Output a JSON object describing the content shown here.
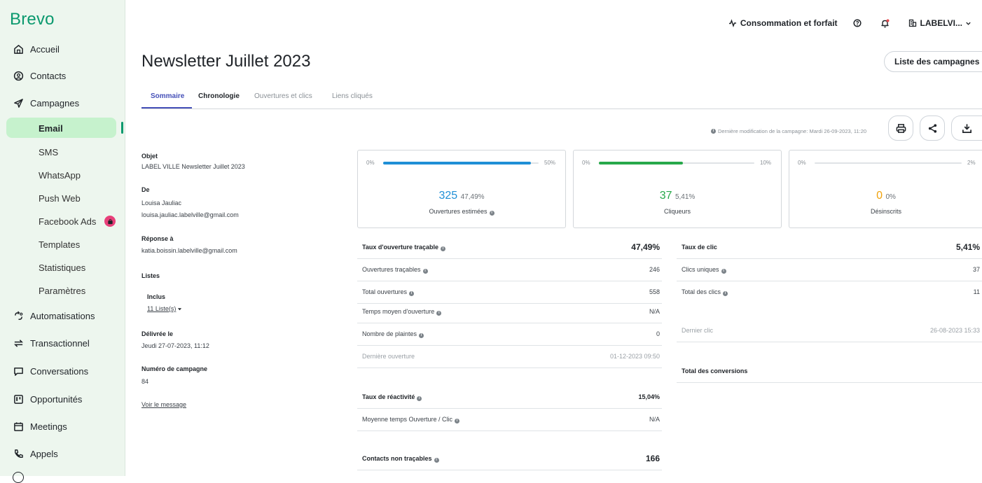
{
  "app": {
    "logo": "Brevo"
  },
  "sidebar": {
    "main_items": [
      {
        "label": "Accueil",
        "icon": "home-icon"
      },
      {
        "label": "Contacts",
        "icon": "contacts-icon"
      },
      {
        "label": "Campagnes",
        "icon": "send-icon"
      }
    ],
    "sub_items": [
      "Email",
      "SMS",
      "WhatsApp",
      "Push Web",
      "Facebook Ads",
      "Templates",
      "Statistiques",
      "Paramètres"
    ],
    "more_items": [
      {
        "label": "Automatisations",
        "icon": "automation-icon"
      },
      {
        "label": "Transactionnel",
        "icon": "transactional-icon"
      },
      {
        "label": "Conversations",
        "icon": "conversations-icon"
      },
      {
        "label": "Opportunités",
        "icon": "opportunities-icon"
      },
      {
        "label": "Meetings",
        "icon": "calendar-icon"
      },
      {
        "label": "Appels",
        "icon": "phone-icon"
      }
    ]
  },
  "topbar": {
    "consumption": "Consommation et forfait",
    "account": "LABELVI..."
  },
  "page": {
    "title": "Newsletter Juillet 2023",
    "list_button": "Liste des campagnes",
    "tabs": [
      "Sommaire",
      "Chronologie",
      "Ouvertures et clics",
      "Liens cliqués"
    ],
    "last_modified": "Dernière modification de la campagne: Mardi 26-09-2023, 11:20"
  },
  "details": {
    "objet_label": "Objet",
    "objet_value": "LABEL VILLE Newsletter Juillet 2023",
    "de_label": "De",
    "de_name": "Louisa Jauliac",
    "de_email": "louisa.jauliac.labelville@gmail.com",
    "reponse_label": "Réponse à",
    "reponse_value": "katia.boissin.labelville@gmail.com",
    "listes_label": "Listes",
    "inclus_label": "Inclus",
    "inclus_value": "11 Liste(s)",
    "delivree_label": "Délivrée le",
    "delivree_value": "Jeudi 27-07-2023, 11:12",
    "numero_label": "Numéro de campagne",
    "numero_value": "84",
    "voir_link": "Voir le message"
  },
  "cards": [
    {
      "min": "0%",
      "max": "50%",
      "count": "325",
      "pct": "47,49%",
      "label": "Ouvertures estimées",
      "progress": 0.95,
      "color": "#1f8fd6"
    },
    {
      "min": "0%",
      "max": "10%",
      "count": "37",
      "pct": "5,41%",
      "label": "Cliqueurs",
      "progress": 0.54,
      "color": "#27a84a"
    },
    {
      "min": "0%",
      "max": "2%",
      "count": "0",
      "pct": "0%",
      "label": "Désinscrits",
      "progress": 0,
      "color": "#f0a20c"
    }
  ],
  "open_stats": [
    {
      "label": "Taux d'ouverture traçable",
      "value": "47,49%"
    },
    {
      "label": "Ouvertures traçables",
      "value": "246"
    },
    {
      "label": "Total ouvertures",
      "value": "558"
    },
    {
      "label": "Temps moyen d'ouverture",
      "value": "N/A"
    },
    {
      "label": "Nombre de plaintes",
      "value": "0"
    },
    {
      "label": "Dernière ouverture",
      "value": "01-12-2023 09:50"
    }
  ],
  "reactivity_stats": [
    {
      "label": "Taux de réactivité",
      "value": "15,04%"
    },
    {
      "label": "Moyenne temps Ouverture / Clic",
      "value": "N/A"
    }
  ],
  "untraceable": {
    "label": "Contacts non traçables",
    "value": "166"
  },
  "click_stats": [
    {
      "label": "Taux de clic",
      "value": "5,41%"
    },
    {
      "label": "Clics uniques",
      "value": "37"
    },
    {
      "label": "Total des clics",
      "value": "11"
    },
    {
      "label": "Dernier clic",
      "value": "26-08-2023 15:33"
    }
  ],
  "conversions": {
    "label": "Total des conversions"
  }
}
